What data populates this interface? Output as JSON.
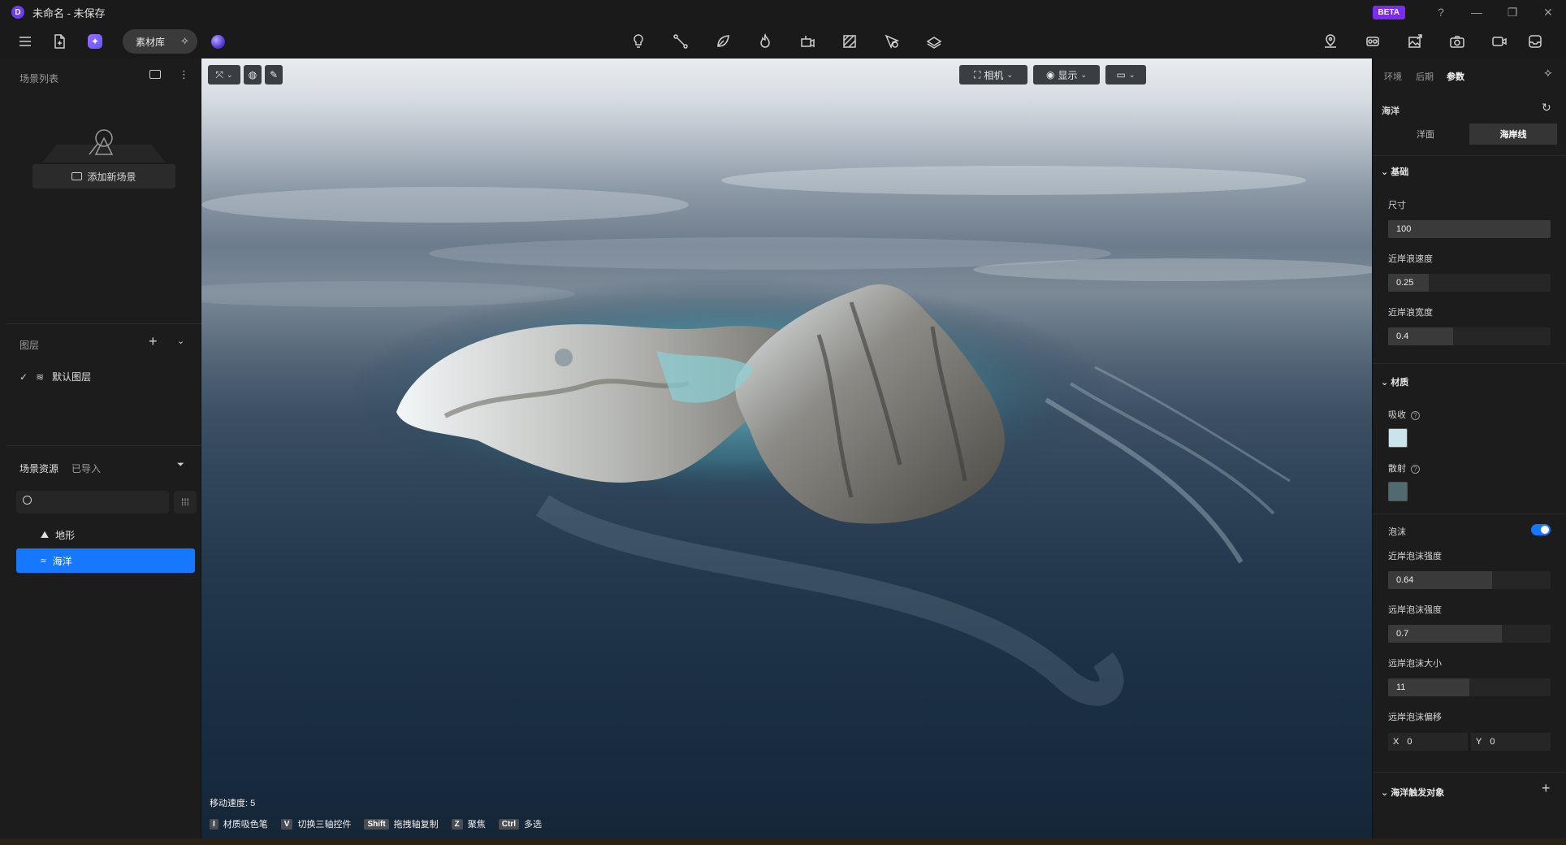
{
  "window": {
    "title": "未命名 - 未保存",
    "beta": "BETA"
  },
  "toolbar": {
    "asset_library": "素材库",
    "center_icons": [
      "light-bulb-icon",
      "path-icon",
      "leaf-icon",
      "fire-icon",
      "object-add-icon",
      "texture-icon",
      "marker-icon",
      "layers-icon"
    ],
    "right_icons": [
      "location-icon",
      "camera-car-icon",
      "image-export-icon",
      "screenshot-icon",
      "video-icon",
      "inbox-icon"
    ]
  },
  "left": {
    "scene_list_title": "场景列表",
    "add_scene": "添加新场景",
    "layers_title": "图层",
    "default_layer": "默认图层",
    "assets_title": "场景资源",
    "imported_tab": "已导入",
    "search_placeholder": "",
    "assets": [
      {
        "label": "地形",
        "icon": "terrain-icon"
      },
      {
        "label": "海洋",
        "icon": "waves-icon"
      }
    ]
  },
  "viewport": {
    "camera_btn": "相机",
    "display_btn": "显示",
    "move_speed": "移动速度: 5",
    "shortcuts": [
      {
        "key": "I",
        "label": "材质吸色笔"
      },
      {
        "key": "V",
        "label": "切换三轴控件"
      },
      {
        "key": "Shift",
        "label": "拖拽轴复制"
      },
      {
        "key": "Z",
        "label": "聚焦"
      },
      {
        "key": "Ctrl",
        "label": "多选"
      }
    ]
  },
  "right": {
    "tabs": [
      "环境",
      "后期",
      "参数"
    ],
    "active_tab": "参数",
    "section_title": "海洋",
    "segments": [
      "洋面",
      "海岸线"
    ],
    "active_segment": "海岸线",
    "basic_group": "基础",
    "size_label": "尺寸",
    "size_value": "100",
    "wave_speed_label": "近岸浪速度",
    "wave_speed_value": "0.25",
    "wave_speed_fill": 0.25,
    "wave_width_label": "近岸浪宽度",
    "wave_width_value": "0.4",
    "wave_width_fill": 0.4,
    "material_group": "材质",
    "absorb_label": "吸收",
    "absorb_color": "#c9e4ea",
    "scatter_label": "散射",
    "scatter_color": "#4f6a70",
    "foam_label": "泡沫",
    "foam_enabled": true,
    "near_foam_label": "近岸泡沫强度",
    "near_foam_value": "0.64",
    "near_foam_fill": 0.64,
    "far_foam_label": "远岸泡沫强度",
    "far_foam_value": "0.7",
    "far_foam_fill": 0.7,
    "far_foam_size_label": "远岸泡沫大小",
    "far_foam_size_value": "11",
    "far_foam_size_fill": 0.5,
    "far_foam_offset_label": "远岸泡沫偏移",
    "offset_x_label": "X",
    "offset_x_value": "0",
    "offset_y_label": "Y",
    "offset_y_value": "0",
    "trigger_group": "海洋触发对象"
  }
}
